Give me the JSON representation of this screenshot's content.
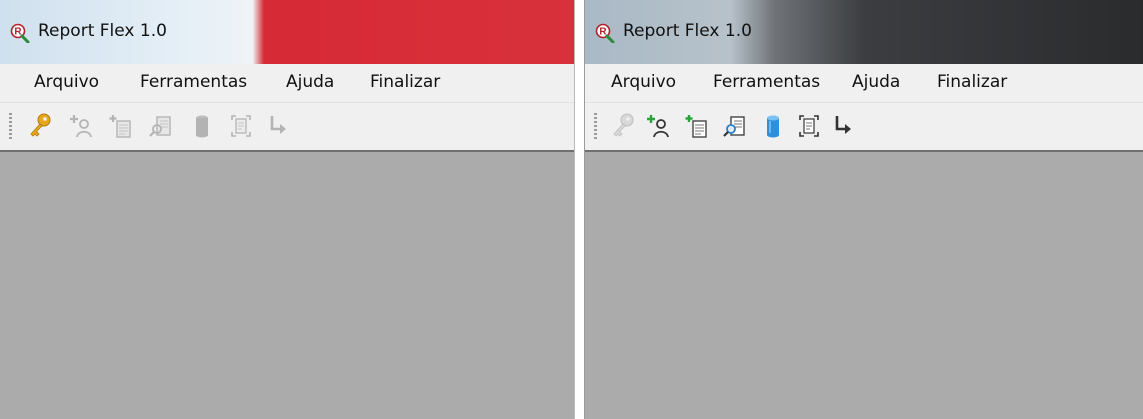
{
  "left_window": {
    "title": "Report Flex 1.0",
    "app_icon": "report-flex-logo-icon",
    "menu": [
      {
        "label": "Arquivo"
      },
      {
        "label": "Ferramentas"
      },
      {
        "label": "Ajuda"
      },
      {
        "label": "Finalizar"
      }
    ],
    "toolbar": [
      {
        "icon": "key-icon",
        "enabled": true
      },
      {
        "icon": "add-user-icon",
        "enabled": false
      },
      {
        "icon": "new-document-icon",
        "enabled": false
      },
      {
        "icon": "search-document-icon",
        "enabled": false
      },
      {
        "icon": "database-icon",
        "enabled": false
      },
      {
        "icon": "document-frame-icon",
        "enabled": false
      },
      {
        "icon": "exit-arrow-icon",
        "enabled": false
      }
    ]
  },
  "right_window": {
    "title": "Report Flex 1.0",
    "app_icon": "report-flex-logo-icon",
    "menu": [
      {
        "label": "Arquivo"
      },
      {
        "label": "Ferramentas"
      },
      {
        "label": "Ajuda"
      },
      {
        "label": "Finalizar"
      }
    ],
    "toolbar": [
      {
        "icon": "key-icon",
        "enabled": false
      },
      {
        "icon": "add-user-icon",
        "enabled": true
      },
      {
        "icon": "new-document-icon",
        "enabled": true
      },
      {
        "icon": "search-document-icon",
        "enabled": true
      },
      {
        "icon": "database-icon",
        "enabled": true
      },
      {
        "icon": "document-frame-icon",
        "enabled": true
      },
      {
        "icon": "exit-arrow-icon",
        "enabled": true
      }
    ]
  },
  "colors": {
    "left_title_accent": "#d62a36",
    "right_title_dark": "#2a2b2d",
    "client_area": "#ababab",
    "key_gold": "#e8a81c",
    "database_blue": "#2f8fd8",
    "plus_green": "#2aa23a"
  }
}
